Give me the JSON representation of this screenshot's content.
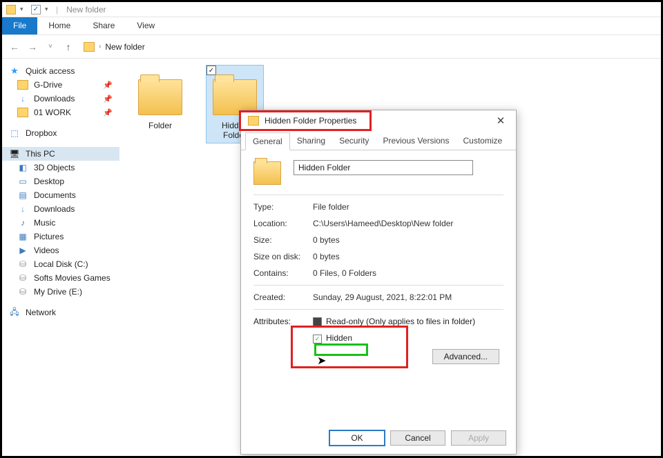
{
  "titlebar": {
    "title": "New folder"
  },
  "ribbon": {
    "file": "File",
    "home": "Home",
    "share": "Share",
    "view": "View"
  },
  "breadcrumb": {
    "current": "New folder"
  },
  "sidebar": {
    "quick_access": "Quick access",
    "qa_items": [
      {
        "label": "G-Drive"
      },
      {
        "label": "Downloads"
      },
      {
        "label": "01 WORK"
      }
    ],
    "dropbox": "Dropbox",
    "this_pc": "This PC",
    "pc_items": [
      {
        "label": "3D Objects"
      },
      {
        "label": "Desktop"
      },
      {
        "label": "Documents"
      },
      {
        "label": "Downloads"
      },
      {
        "label": "Music"
      },
      {
        "label": "Pictures"
      },
      {
        "label": "Videos"
      },
      {
        "label": "Local Disk (C:)"
      },
      {
        "label": "Softs Movies Games"
      },
      {
        "label": "My Drive (E:)"
      }
    ],
    "network": "Network"
  },
  "files": [
    {
      "label": "Folder"
    },
    {
      "label": "Hidden Folder"
    }
  ],
  "dialog": {
    "title": "Hidden Folder Properties",
    "tabs": {
      "general": "General",
      "sharing": "Sharing",
      "security": "Security",
      "prev": "Previous Versions",
      "customize": "Customize"
    },
    "name_value": "Hidden Folder",
    "type_label": "Type:",
    "type_value": "File folder",
    "location_label": "Location:",
    "location_value": "C:\\Users\\Hameed\\Desktop\\New folder",
    "size_label": "Size:",
    "size_value": "0 bytes",
    "sod_label": "Size on disk:",
    "sod_value": "0 bytes",
    "contains_label": "Contains:",
    "contains_value": "0 Files, 0 Folders",
    "created_label": "Created:",
    "created_value": "Sunday, 29 August, 2021, 8:22:01 PM",
    "attrs_label": "Attributes:",
    "readonly_label": "Read-only (Only applies to files in folder)",
    "hidden_label": "Hidden",
    "advanced": "Advanced...",
    "ok": "OK",
    "cancel": "Cancel",
    "apply": "Apply"
  }
}
